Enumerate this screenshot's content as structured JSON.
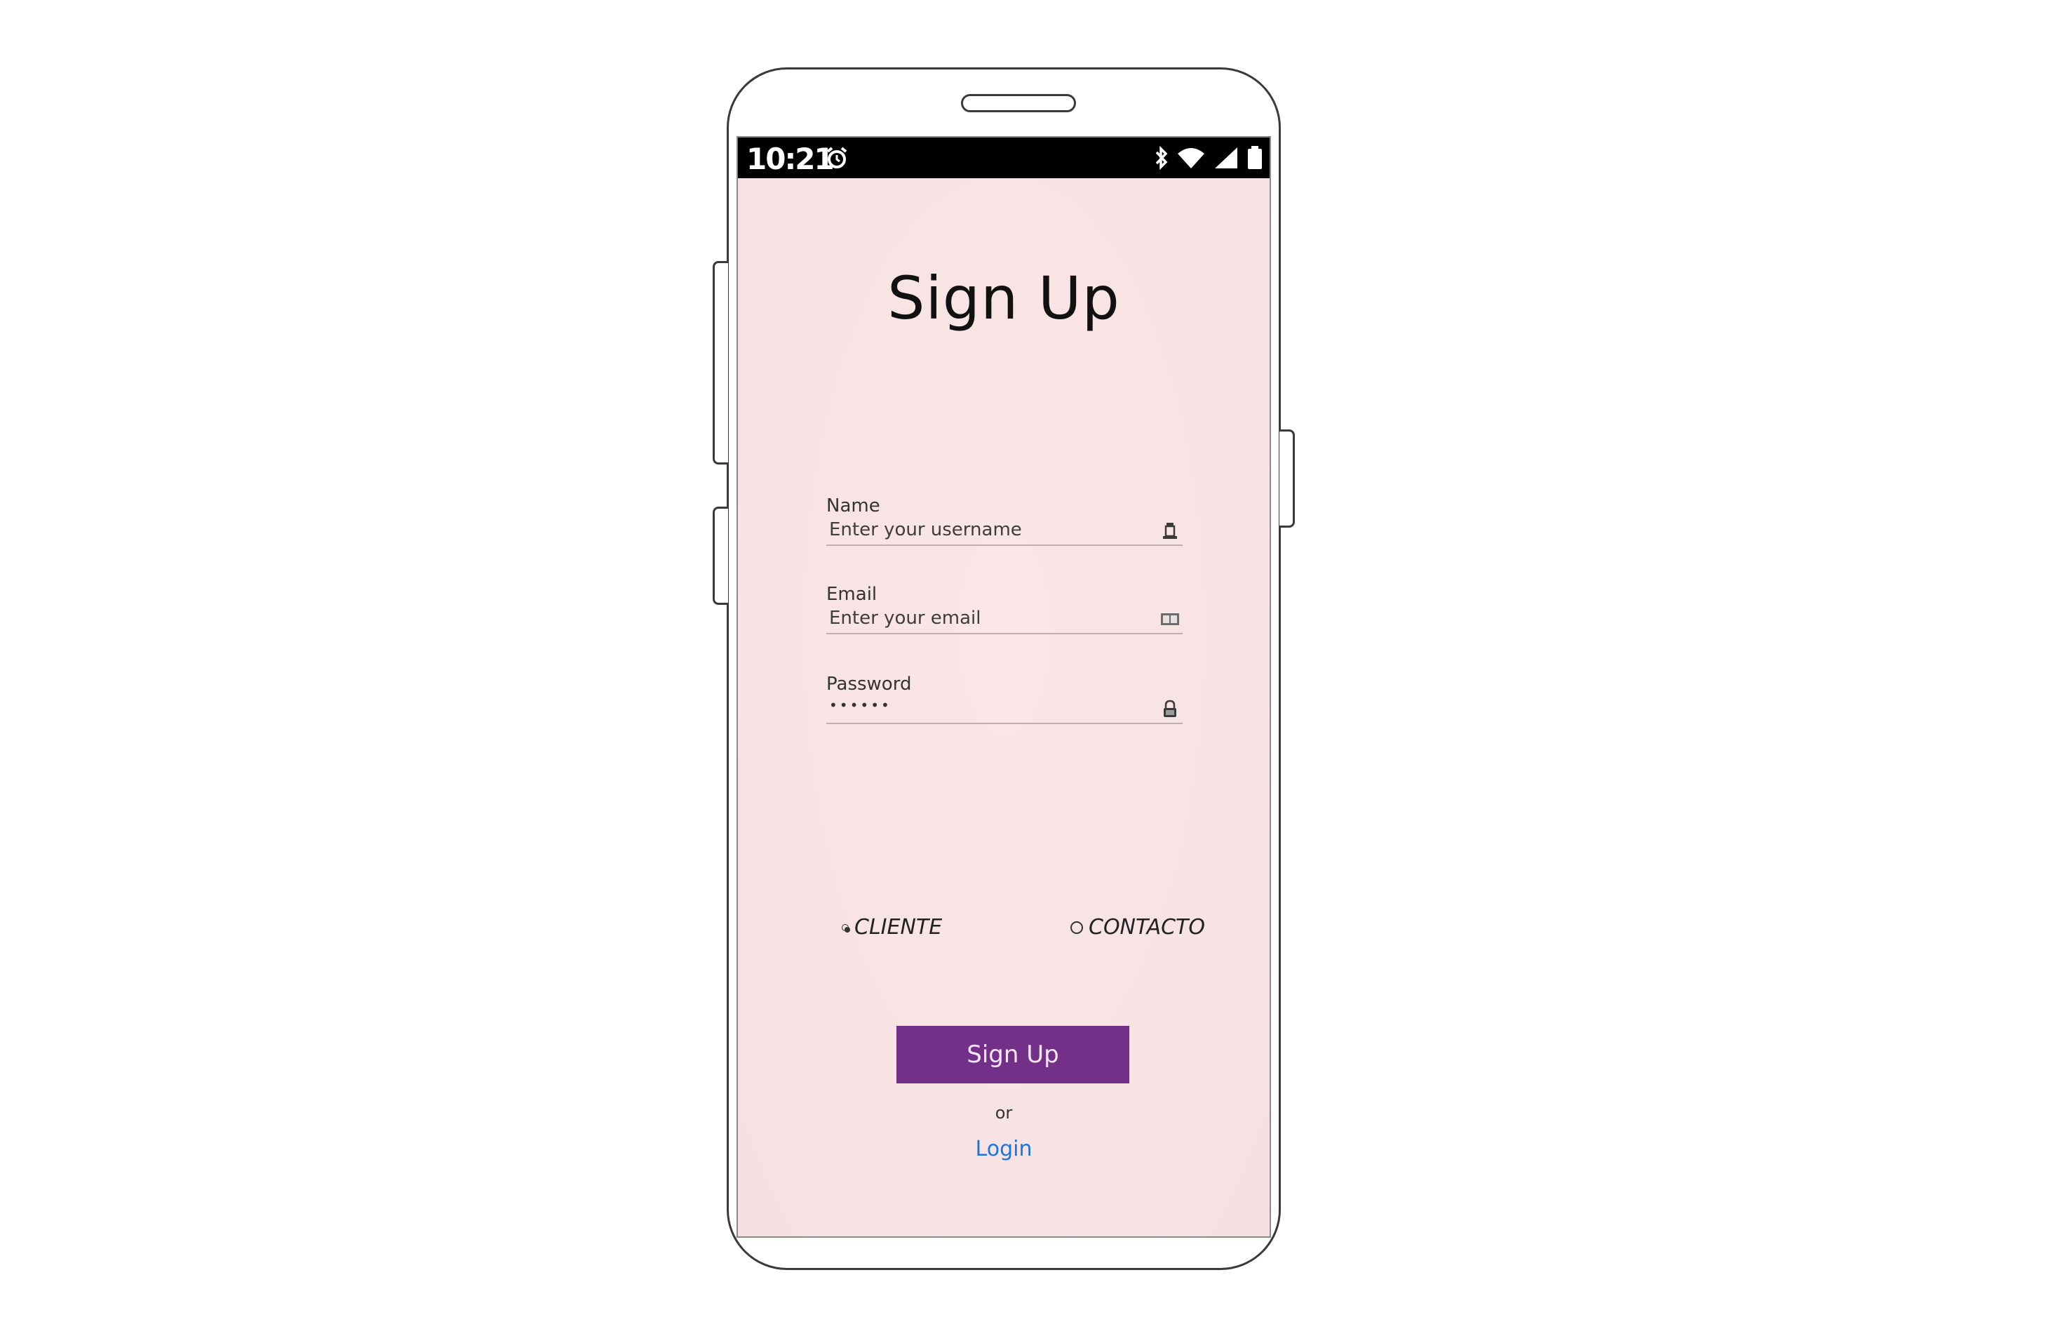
{
  "status_bar": {
    "time": "10:21",
    "icons": [
      "alarm-icon",
      "bluetooth-icon",
      "wifi-icon",
      "cellular-signal-icon",
      "battery-icon"
    ]
  },
  "screen": {
    "title": "Sign Up",
    "background_color": "#f8e3e4"
  },
  "form": {
    "name": {
      "label": "Name",
      "placeholder": "Enter your username",
      "icon": "user-icon"
    },
    "email": {
      "label": "Email",
      "placeholder": "Enter your email",
      "icon": "mail-icon"
    },
    "password": {
      "label": "Password",
      "value": "••••••",
      "icon": "lock-icon"
    },
    "roles": [
      {
        "label": "CLIENTE",
        "checked": true
      },
      {
        "label": "CONTACTO",
        "checked": false
      }
    ],
    "submit_label": "Sign Up",
    "submit_color": "#733088"
  },
  "footer": {
    "or_text": "or",
    "login_label": "Login",
    "login_color": "#1976e0"
  }
}
